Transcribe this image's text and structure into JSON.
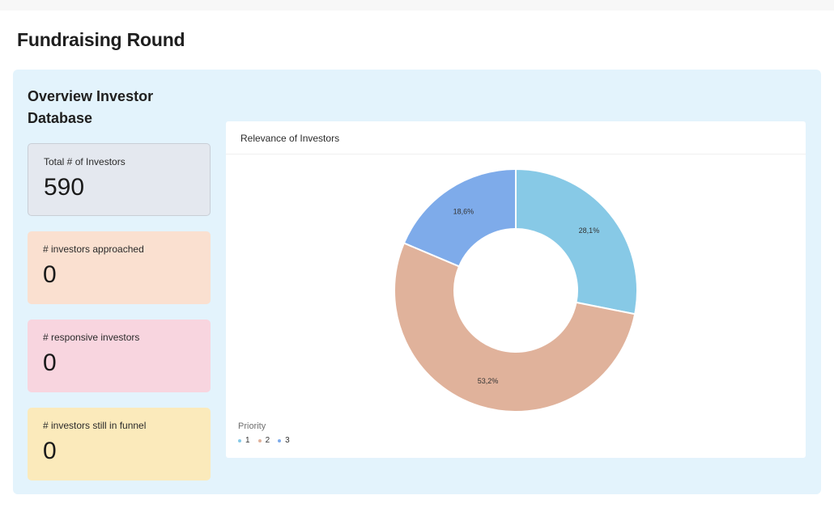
{
  "page": {
    "title": "Fundraising Round"
  },
  "panel": {
    "title": "Overview Investor Database",
    "stats": [
      {
        "label": "Total # of Investors",
        "value": "590"
      },
      {
        "label": "# investors approached",
        "value": "0"
      },
      {
        "label": "# responsive investors",
        "value": "0"
      },
      {
        "label": "# investors still in funnel",
        "value": "0"
      }
    ]
  },
  "chart_data": {
    "type": "pie",
    "variant": "donut",
    "title": "Relevance of Investors",
    "legend_title": "Priority",
    "legend_placement": "bottom-left",
    "categories": [
      "1",
      "2",
      "3"
    ],
    "values": [
      28.1,
      53.2,
      18.6
    ],
    "labels": [
      "28,1%",
      "53,2%",
      "18,6%"
    ],
    "colors": [
      "#87c9e6",
      "#e0b29b",
      "#7eabea"
    ]
  }
}
